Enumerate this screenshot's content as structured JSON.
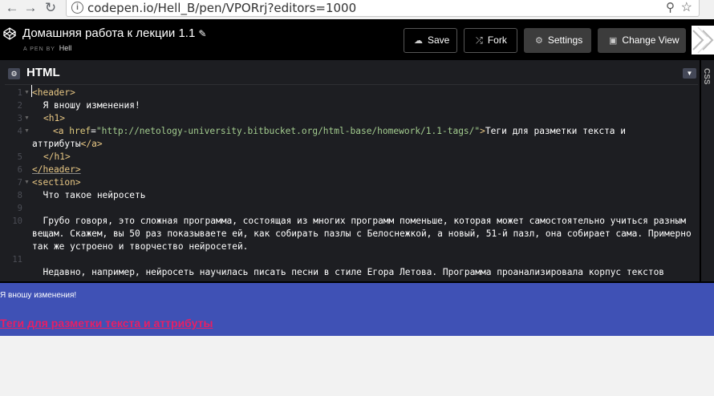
{
  "browser": {
    "url": "codepen.io/Hell_B/pen/VPORrj?editors=1000",
    "back_icon": "arrow-left",
    "forward_icon": "arrow-right",
    "reload_icon": "reload"
  },
  "header": {
    "title": "Домашняя работа к лекции 1.1",
    "pen_by": "A PEN BY",
    "author": "Hell",
    "buttons": {
      "save": "Save",
      "fork": "Fork",
      "settings": "Settings",
      "change_view": "Change View"
    }
  },
  "editor": {
    "panel_label": "HTML",
    "side_tab_label": "CSS",
    "line_numbers": [
      "1",
      "2",
      "3",
      "4",
      "",
      "5",
      "6",
      "7",
      "8",
      "9",
      "10",
      "",
      "",
      "11"
    ],
    "lines": {
      "l1_tag": "<header>",
      "l2_text": "  Я вношу изменения!",
      "l3_tag": "<h1>",
      "l4_open": "<a ",
      "l4_attr": "href",
      "l4_eq": "=",
      "l4_str": "\"http://netology-university.bitbucket.org/html-base/homework/1.1-tags/\"",
      "l4_close": ">",
      "l4_text": "Теги для разметки текста и",
      "l4b_text": "аттрибуты",
      "l4b_tag": "</a>",
      "l5_tag": "</h1>",
      "l6_tag": "</header>",
      "l7_tag": "<section>",
      "l8_text": "  Что такое нейросеть",
      "l10_text": "  Грубо говоря, это сложная программа, состоящая из многих программ поменьше, которая может самостоятельно учиться разным",
      "l10b_text": "вещам. Скажем, вы 50 раз показываете ей, как собирать пазлы с Белоснежкой, а новый, 51-й пазл, она собирает сама. Примерно",
      "l10c_text": "так же устроено и творчество нейросетей.",
      "l12_text": "  Недавно, например, нейросеть научилась писать песни в стиле Егора Летова. Программа проанализировала корпус текстов"
    }
  },
  "preview": {
    "text": "Я вношу изменения!",
    "link": "Теги для разметки текста и аттрибуты",
    "colors": {
      "banner": "#3f51b5",
      "link": "#e91e63"
    }
  }
}
